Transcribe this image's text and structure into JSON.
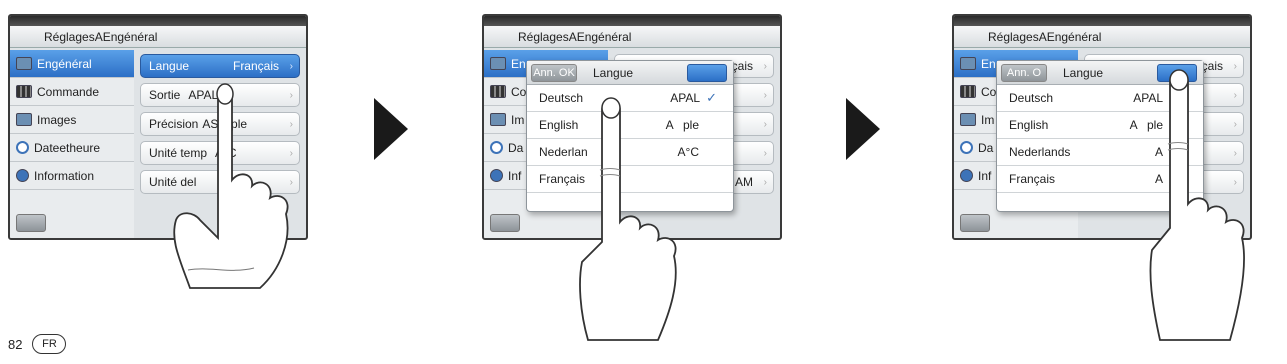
{
  "panel1": {
    "crumb": "RéglagesAEngénéral",
    "sidebar": [
      {
        "label": "Engénéral",
        "icon": "settings-icon"
      },
      {
        "label": "Commande",
        "icon": "film-icon"
      },
      {
        "label": "Images",
        "icon": "image-icon"
      },
      {
        "label": "Dateetheure",
        "icon": "clock-icon"
      },
      {
        "label": "Information",
        "icon": "info-icon"
      }
    ],
    "rows": [
      {
        "label": "Langue",
        "value": "Français"
      },
      {
        "label": "Sortie",
        "value": "APAL"
      },
      {
        "label": "Précision",
        "value": "ASimple"
      },
      {
        "label": "Unité temp",
        "value": "A°C"
      },
      {
        "label": "Unité del",
        "value": "A"
      }
    ]
  },
  "panel2": {
    "crumb": "RéglagesAEngénéral",
    "sidebar": [
      "Eng",
      "Co",
      "Im",
      "Da",
      "Inf"
    ],
    "rows_right": [
      "çais",
      "",
      "",
      "",
      "AM"
    ],
    "dialog": {
      "cancel": "Ann. OK",
      "title": "Langue",
      "options": [
        {
          "label": "Deutsch",
          "value": "APAL",
          "checked": true
        },
        {
          "label": "English",
          "value": "A   ple",
          "checked": false
        },
        {
          "label": "Nederlan",
          "value": "A°C",
          "checked": false
        },
        {
          "label": "Français",
          "value": "",
          "checked": false
        }
      ]
    }
  },
  "panel3": {
    "crumb": "RéglagesAEngénéral",
    "sidebar": [
      "Eng",
      "Co",
      "Im",
      "Da",
      "Inf"
    ],
    "rows_right": [
      "çais",
      "",
      "",
      "",
      ""
    ],
    "dialog": {
      "cancel": "Ann. O",
      "title": "Langue",
      "options": [
        {
          "label": "Deutsch",
          "value": "APAL"
        },
        {
          "label": "English",
          "value": "A   ple"
        },
        {
          "label": "Nederlands",
          "value": "A"
        },
        {
          "label": "Français",
          "value": "A"
        }
      ]
    }
  },
  "footer": {
    "page": "82",
    "badge": "FR"
  }
}
